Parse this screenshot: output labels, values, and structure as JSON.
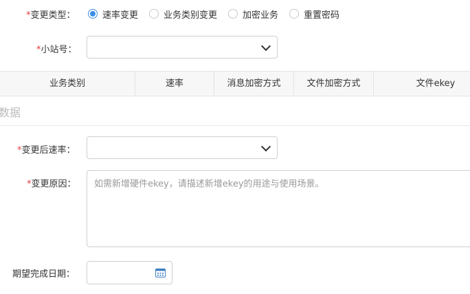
{
  "form": {
    "change_type": {
      "required_mark": "*",
      "label": "变更类型：",
      "options": [
        {
          "label": "速率变更",
          "checked": true
        },
        {
          "label": "业务类别变更",
          "checked": false
        },
        {
          "label": "加密业务",
          "checked": false
        },
        {
          "label": "重置密码",
          "checked": false
        }
      ]
    },
    "station": {
      "required_mark": "*",
      "label": "小站号：",
      "value": ""
    },
    "table": {
      "headers": [
        "业务类别",
        "速率",
        "消息加密方式",
        "文件加密方式",
        "文件ekey"
      ]
    },
    "section_title": "数据",
    "new_rate": {
      "required_mark": "*",
      "label": "变更后速率：",
      "value": ""
    },
    "reason": {
      "required_mark": "*",
      "label": "变更原因：",
      "placeholder": "如需新增硬件ekey，请描述新增ekey的用途与使用场景。"
    },
    "expected_date": {
      "label": "期望完成日期：",
      "value": ""
    }
  },
  "colors": {
    "required": "#e4393c",
    "accent": "#3a8ee6",
    "calendar_icon": "#3d7fc1"
  }
}
